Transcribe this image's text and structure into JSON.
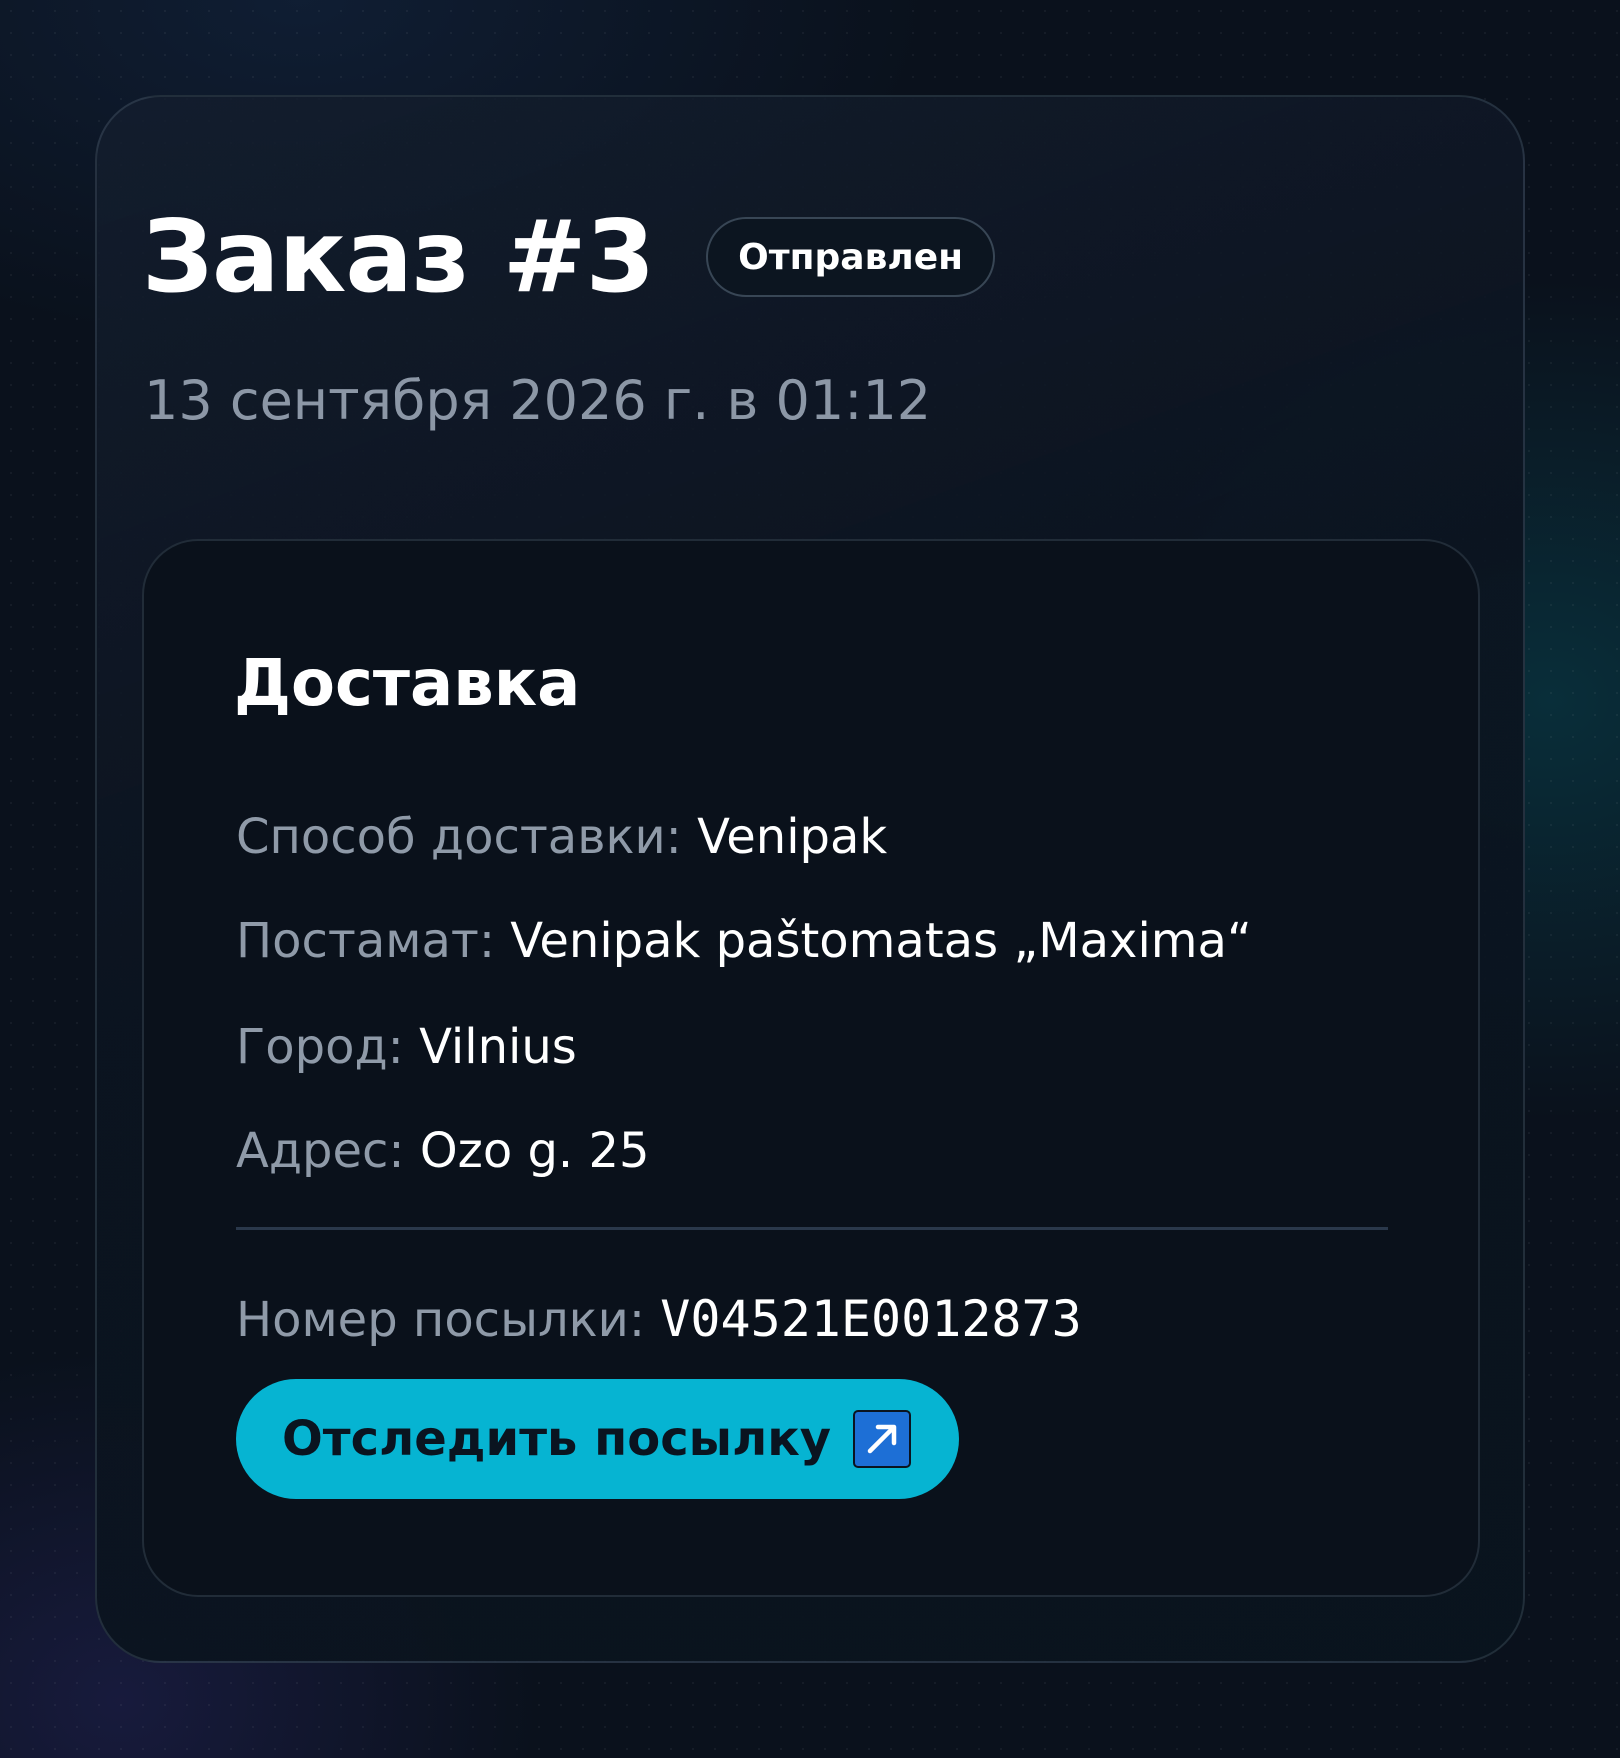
{
  "order": {
    "title": "Заказ #3",
    "status": "Отправлен",
    "date": "13 сентября 2026 г. в 01:12"
  },
  "delivery": {
    "section_title": "Доставка",
    "method_label": "Способ доставки:",
    "method_value": "Venipak",
    "locker_label": "Постамат:",
    "locker_value": "Venipak paštomatas „Maxima“",
    "city_label": "Город:",
    "city_value": "Vilnius",
    "address_label": "Адрес:",
    "address_value": "Ozo g. 25",
    "parcel_label": "Номер посылки:",
    "parcel_value": "V04521E0012873",
    "track_button_label": "Отследить посылку",
    "track_button_icon": "external-link-icon"
  },
  "colors": {
    "accent": "#06b4d2",
    "icon_blue": "#1d6fd6",
    "background": "#0a111c"
  }
}
